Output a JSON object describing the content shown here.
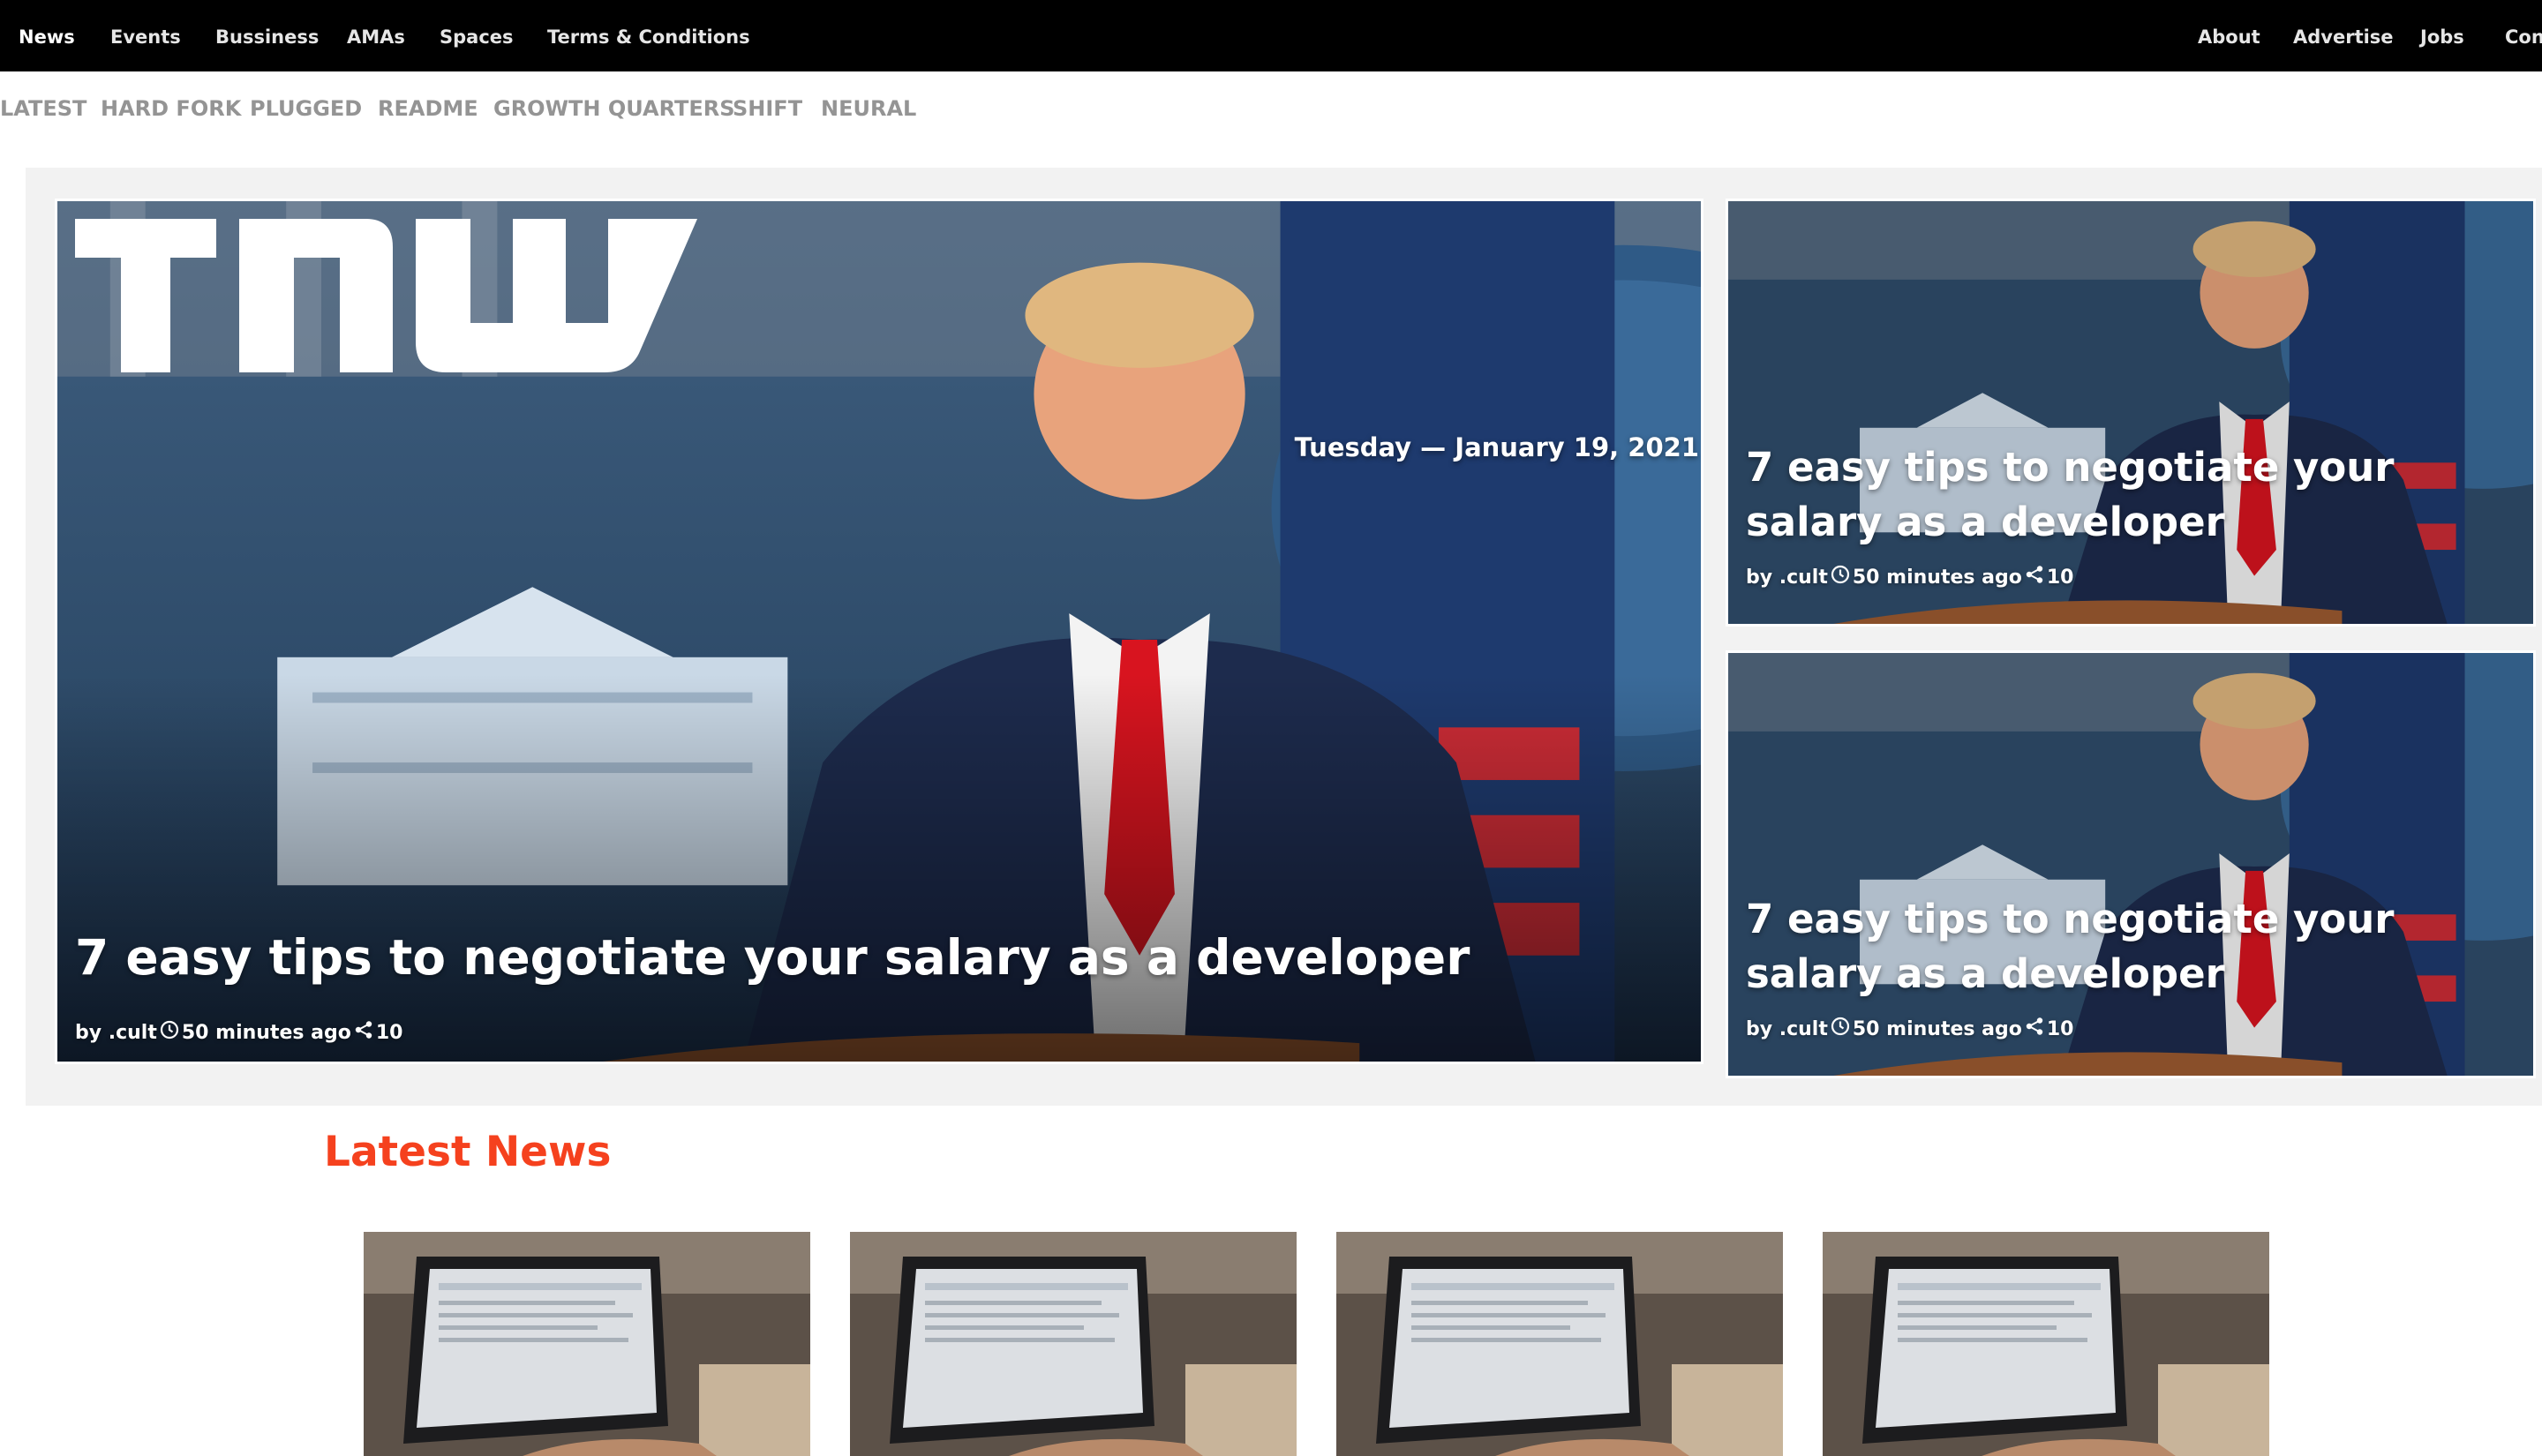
{
  "top_nav": {
    "left": [
      "News",
      "Events",
      "Bussiness",
      "AMAs",
      "Spaces",
      "Terms & Conditions"
    ],
    "right": [
      "About",
      "Advertise",
      "Jobs",
      "Cont"
    ],
    "active": "News"
  },
  "section_nav": [
    "LATEST",
    "HARD FORK",
    "PLUGGED",
    "README",
    "GROWTH QUARTERS",
    "SHIFT",
    "NEURAL"
  ],
  "hero": {
    "logo_text": "TNW",
    "date": "Tuesday — January 19, 2021",
    "main": {
      "title": "7 easy tips to negotiate your salary as a developer",
      "author": "by .cult",
      "time": "50 minutes ago",
      "shares": "10"
    },
    "side": [
      {
        "title": "7 easy tips to negotiate your salary as a developer",
        "author": "by .cult",
        "time": "50 minutes ago",
        "shares": "10"
      },
      {
        "title": "7 easy tips to negotiate your salary as a developer",
        "author": "by .cult",
        "time": "50 minutes ago",
        "shares": "10"
      }
    ]
  },
  "latest_news": {
    "heading": "Latest News",
    "heading_color": "#f5411e"
  },
  "icons": {
    "clock": "clock-icon",
    "share": "share-icon"
  }
}
